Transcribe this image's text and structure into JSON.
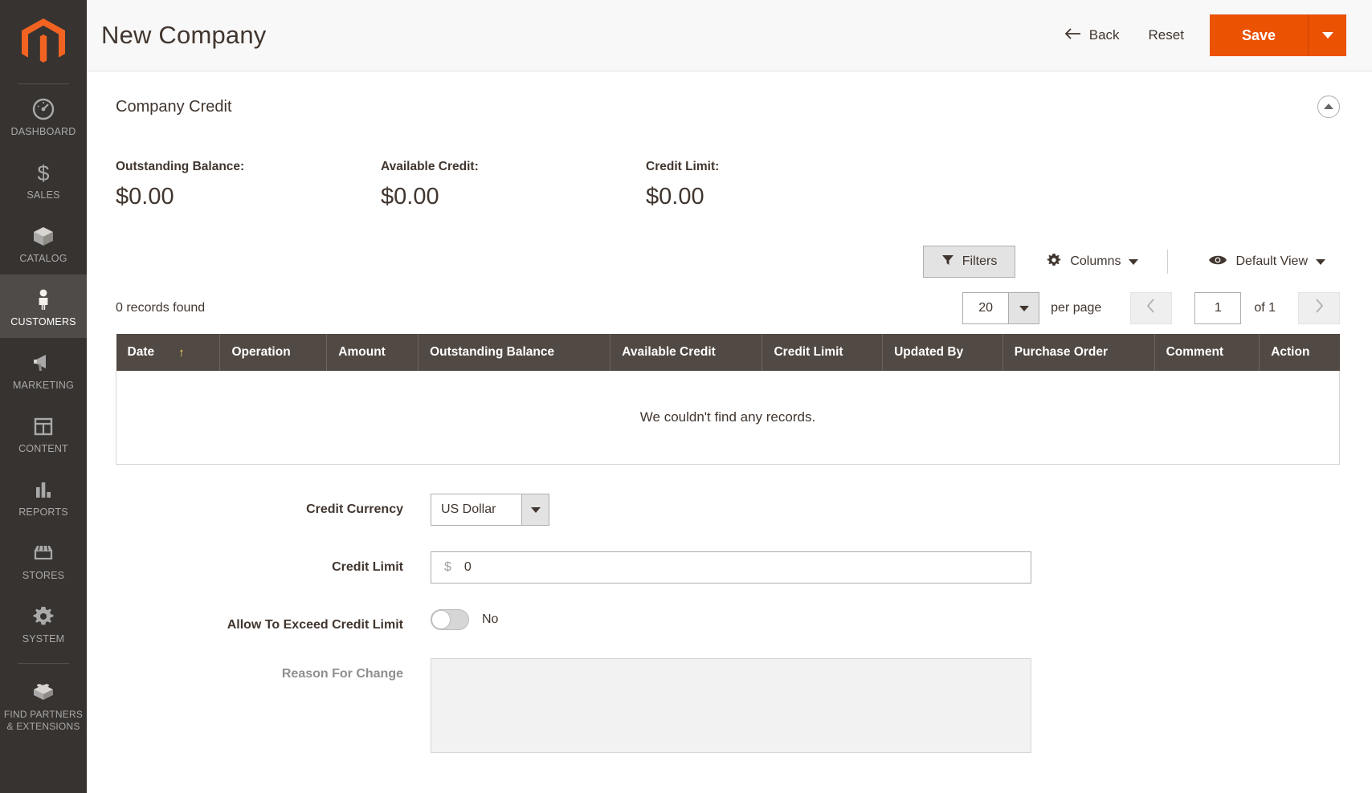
{
  "sidebar": {
    "logo_name": "magento-logo",
    "items": [
      {
        "label": "DASHBOARD",
        "icon": "dashboard-gauge-icon",
        "active": false
      },
      {
        "label": "SALES",
        "icon": "dollar-sign-icon",
        "active": false
      },
      {
        "label": "CATALOG",
        "icon": "box-icon",
        "active": false
      },
      {
        "label": "CUSTOMERS",
        "icon": "person-icon",
        "active": true
      },
      {
        "label": "MARKETING",
        "icon": "megaphone-icon",
        "active": false
      },
      {
        "label": "CONTENT",
        "icon": "layout-window-icon",
        "active": false
      },
      {
        "label": "REPORTS",
        "icon": "bar-chart-icon",
        "active": false
      },
      {
        "label": "STORES",
        "icon": "storefront-icon",
        "active": false
      },
      {
        "label": "SYSTEM",
        "icon": "gear-icon",
        "active": false
      },
      {
        "label": "FIND PARTNERS\n& EXTENSIONS",
        "icon": "lego-brick-icon",
        "active": false
      }
    ],
    "find_partners_line1": "FIND PARTNERS",
    "find_partners_line2": "& EXTENSIONS"
  },
  "header": {
    "title": "New Company",
    "back_label": "Back",
    "back_icon": "arrow-left-icon",
    "reset_label": "Reset",
    "save_label": "Save",
    "save_caret_icon": "chevron-down-icon",
    "accent_color": "#eb5202"
  },
  "section": {
    "title": "Company Credit",
    "collapse_icon": "chevron-up-icon"
  },
  "balances": [
    {
      "label": "Outstanding Balance:",
      "value": "$0.00"
    },
    {
      "label": "Available Credit:",
      "value": "$0.00"
    },
    {
      "label": "Credit Limit:",
      "value": "$0.00"
    }
  ],
  "grid_toolbar": {
    "filters_label": "Filters",
    "filters_icon": "funnel-icon",
    "columns_label": "Columns",
    "columns_icon": "gear-icon",
    "columns_caret_icon": "chevron-down-icon",
    "view_label": "Default View",
    "view_icon": "eye-icon",
    "view_caret_icon": "chevron-down-icon"
  },
  "grid_meta": {
    "records_found": "0 records found",
    "per_page_value": "20",
    "per_page_label": "per page",
    "prev_icon": "chevron-left-icon",
    "next_icon": "chevron-right-icon",
    "page_value": "1",
    "page_of": "of 1"
  },
  "table": {
    "columns": [
      {
        "label": "Date",
        "sorted": true,
        "sort_icon": "↑"
      },
      {
        "label": "Operation",
        "sorted": false
      },
      {
        "label": "Amount",
        "sorted": false
      },
      {
        "label": "Outstanding Balance",
        "sorted": false
      },
      {
        "label": "Available Credit",
        "sorted": false
      },
      {
        "label": "Credit Limit",
        "sorted": false
      },
      {
        "label": "Updated By",
        "sorted": false
      },
      {
        "label": "Purchase Order",
        "sorted": false
      },
      {
        "label": "Comment",
        "sorted": false
      },
      {
        "label": "Action",
        "sorted": false
      }
    ],
    "rows": [],
    "empty_message": "We couldn't find any records."
  },
  "form": {
    "credit_currency": {
      "label": "Credit Currency",
      "value": "US Dollar",
      "caret_icon": "chevron-down-icon"
    },
    "credit_limit": {
      "label": "Credit Limit",
      "currency_symbol": "$",
      "value": "0"
    },
    "allow_exceed": {
      "label": "Allow To Exceed Credit Limit",
      "state_text": "No",
      "checked": false
    },
    "reason_for_change": {
      "label": "Reason For Change",
      "value": "",
      "placeholder": ""
    }
  }
}
